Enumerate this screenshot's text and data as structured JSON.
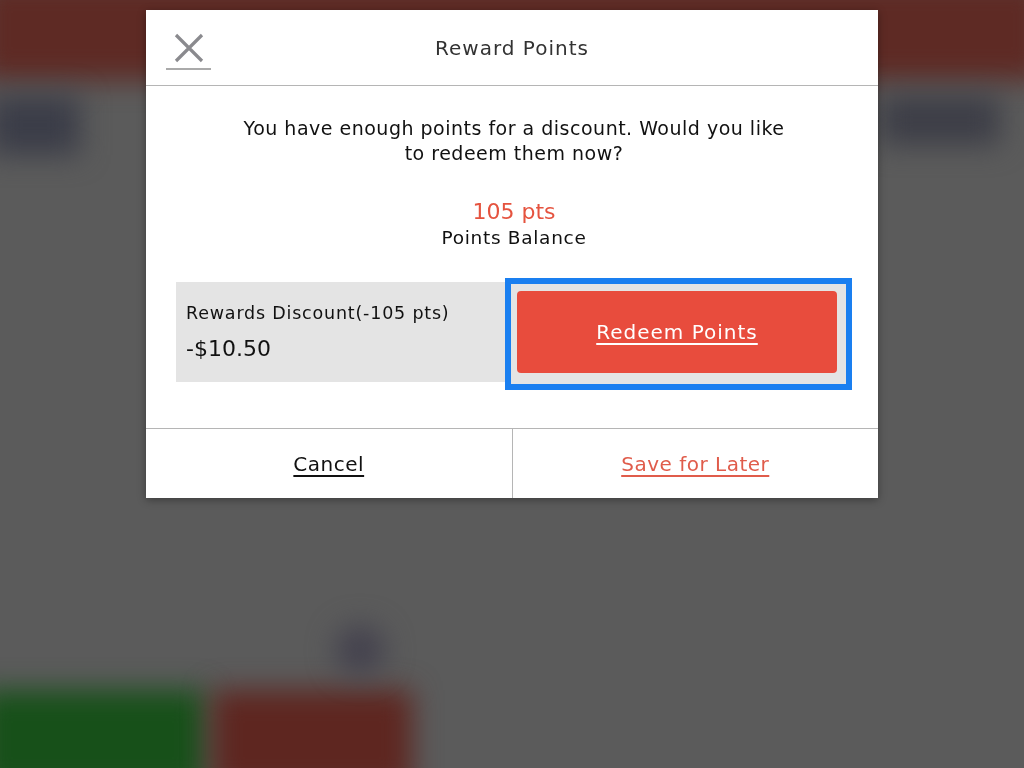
{
  "dialog": {
    "title": "Reward Points",
    "message": "You have enough points for a discount. Would you like to redeem them now?",
    "points": "105 pts",
    "points_label": "Points Balance",
    "discount": {
      "label": "Rewards Discount(-105 pts)",
      "amount": "-$10.50"
    },
    "redeem_button": {
      "label": "Redeem Points",
      "focused": true
    },
    "footer_buttons": [
      {
        "label": "Cancel",
        "kind": "default"
      },
      {
        "label": "Save for Later",
        "kind": "accent"
      }
    ]
  }
}
